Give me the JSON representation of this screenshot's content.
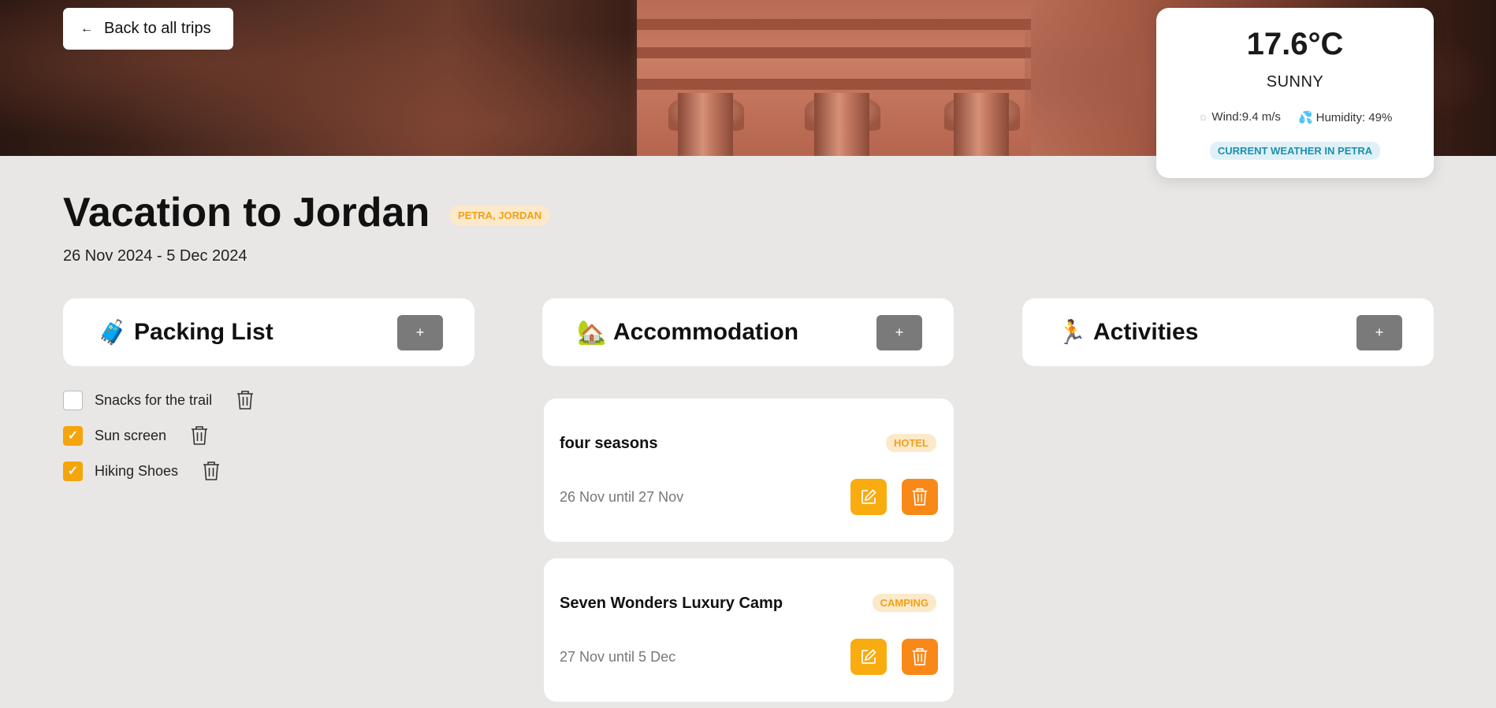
{
  "nav": {
    "back_label": "Back to all trips"
  },
  "weather": {
    "temperature": "17.6°C",
    "condition": "SUNNY",
    "wind": "Wind:9.4 m/s",
    "humidity": "Humidity: 49%",
    "badge": "CURRENT WEATHER IN PETRA"
  },
  "trip": {
    "title": "Vacation to Jordan",
    "location": "PETRA, JORDAN",
    "dates": "26 Nov 2024 - 5 Dec 2024"
  },
  "sections": {
    "packing": {
      "emoji": "🧳",
      "label": "Packing List",
      "add": "+"
    },
    "accommodation": {
      "emoji": "🏡",
      "label": "Accommodation",
      "add": "+"
    },
    "activities": {
      "emoji": "🏃",
      "label": "Activities",
      "add": "+"
    }
  },
  "packing_items": [
    {
      "label": "Snacks for the trail",
      "checked": false
    },
    {
      "label": "Sun screen",
      "checked": true
    },
    {
      "label": "Hiking Shoes",
      "checked": true
    }
  ],
  "accommodations": [
    {
      "name": "four seasons",
      "type": "HOTEL",
      "period": "26 Nov until 27 Nov"
    },
    {
      "name": "Seven Wonders Luxury Camp",
      "type": "CAMPING",
      "period": "27 Nov until 5 Dec"
    }
  ],
  "colors": {
    "accent": "#f5a50c",
    "delete": "#f88918",
    "add_button": "#7a7a7a",
    "background": "#e9e7e5"
  }
}
